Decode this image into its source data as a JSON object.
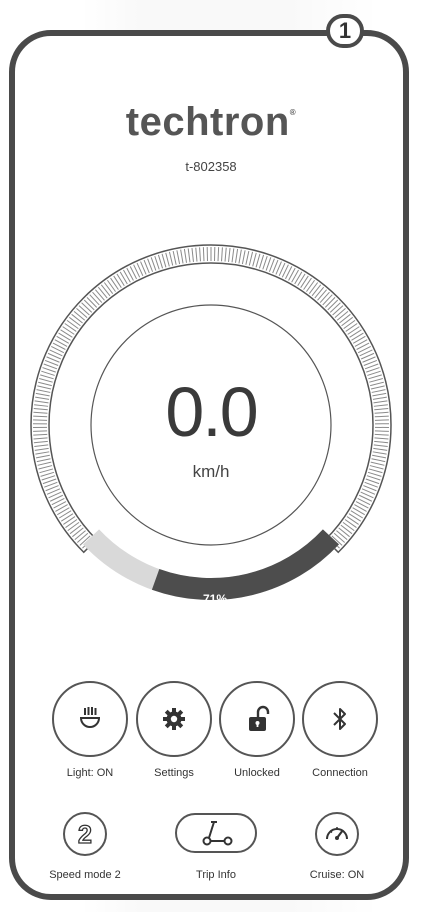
{
  "marker": "1",
  "brand": {
    "name": "techtron",
    "trademark": "®"
  },
  "device_id": "t-802358",
  "speed": {
    "value": "0.0",
    "unit": "km/h"
  },
  "battery": {
    "label": "71%",
    "level": 0.71
  },
  "controls": [
    {
      "label": "Light: ON",
      "icon": "headlight-icon"
    },
    {
      "label": "Settings",
      "icon": "gear-icon"
    },
    {
      "label": "Unlocked",
      "icon": "unlocked-padlock-icon"
    },
    {
      "label": "Connection",
      "icon": "bluetooth-icon"
    }
  ],
  "bottom": {
    "speed_mode": {
      "label": "Speed mode 2",
      "value": "2"
    },
    "trip_info": {
      "label": "Trip Info",
      "icon": "scooter-icon"
    },
    "cruise": {
      "label": "Cruise: ON",
      "icon": "speedometer-icon"
    }
  }
}
